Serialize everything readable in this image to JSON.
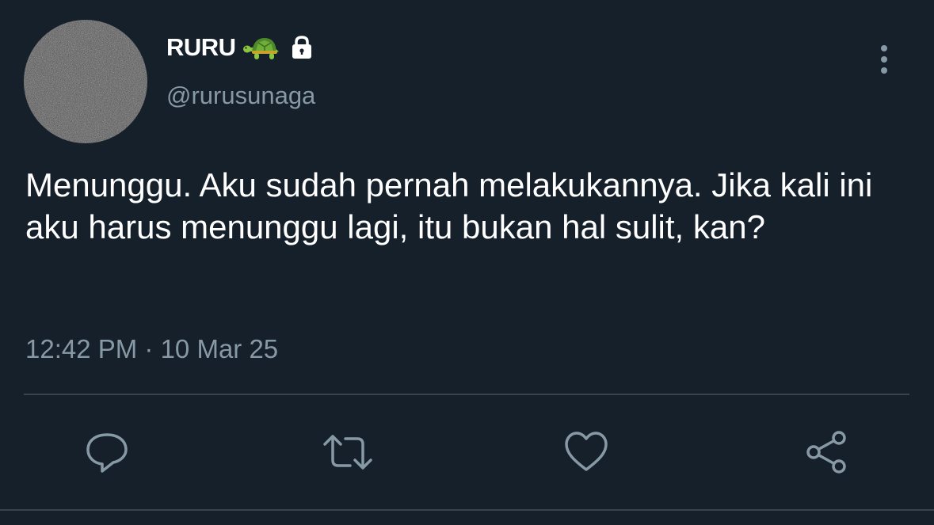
{
  "tweet": {
    "display_name": "RURU",
    "name_badges": [
      "turtle-emoji",
      "lock-icon"
    ],
    "handle": "@rurusunaga",
    "text": "Menunggu. Aku sudah pernah melakukannya. Jika kali ini aku harus menunggu lagi, itu bukan hal sulit, kan?",
    "timestamp": "12:42 PM · 10 Mar 25"
  },
  "actions": [
    "reply-icon",
    "retweet-icon",
    "like-icon",
    "share-icon"
  ],
  "colors": {
    "background": "#15202b",
    "secondary_text": "#8899a6",
    "divider": "#38444d",
    "primary_text": "#ffffff"
  }
}
